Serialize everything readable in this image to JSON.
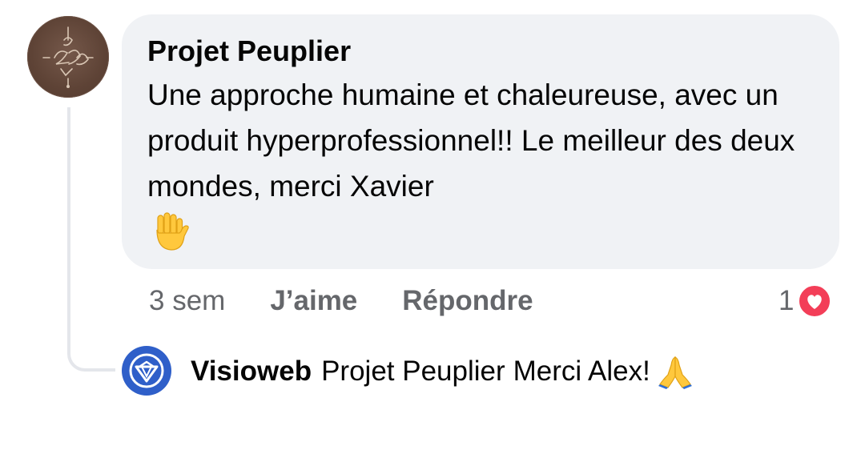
{
  "comment": {
    "author": "Projet Peuplier",
    "text": "Une approche humaine et chaleureuse, avec un produit hyperprofessionnel!! Le meilleur des deux mondes, merci Xavier",
    "emoji": "raised-hand",
    "avatar_icon": "handwritten-logo-avatar"
  },
  "actions": {
    "time": "3 sem",
    "like_label": "J’aime",
    "reply_label": "Répondre",
    "reaction_count": "1",
    "reaction_icon": "heart-icon",
    "reaction_color": "#f33e58"
  },
  "reply": {
    "author": "Visioweb",
    "mention": "Projet Peuplier",
    "text": "Merci Alex!",
    "emoji": "folded-hands",
    "avatar_icon": "diamond-logo-avatar",
    "avatar_color": "#2f5fc9"
  },
  "colors": {
    "bubble_bg": "#f0f2f5",
    "meta_text": "#65676b",
    "thread_line": "#e4e6eb"
  }
}
